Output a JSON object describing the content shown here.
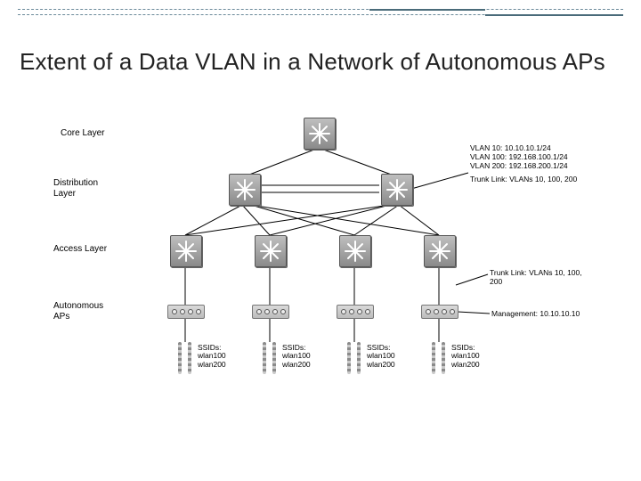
{
  "title": "Extent of a Data VLAN in a Network of Autonomous APs",
  "layers": {
    "core": "Core Layer",
    "distribution": "Distribution\nLayer",
    "access": "Access Layer",
    "aps": "Autonomous\nAPs"
  },
  "vlan_box": {
    "l1": "VLAN 10: 10.10.10.1/24",
    "l2": "VLAN 100: 192.168.100.1/24",
    "l3": "VLAN 200: 192.168.200.1/24",
    "l4": "Trunk Link: VLANs 10, 100, 200"
  },
  "trunk_label": "Trunk Link: VLANs 10, 100, 200",
  "mgmt_label": "Management: 10.10.10.10",
  "ssid": {
    "h": "SSIDs:",
    "s1": "wlan100",
    "s2": "wlan200"
  },
  "ap_count": 4
}
